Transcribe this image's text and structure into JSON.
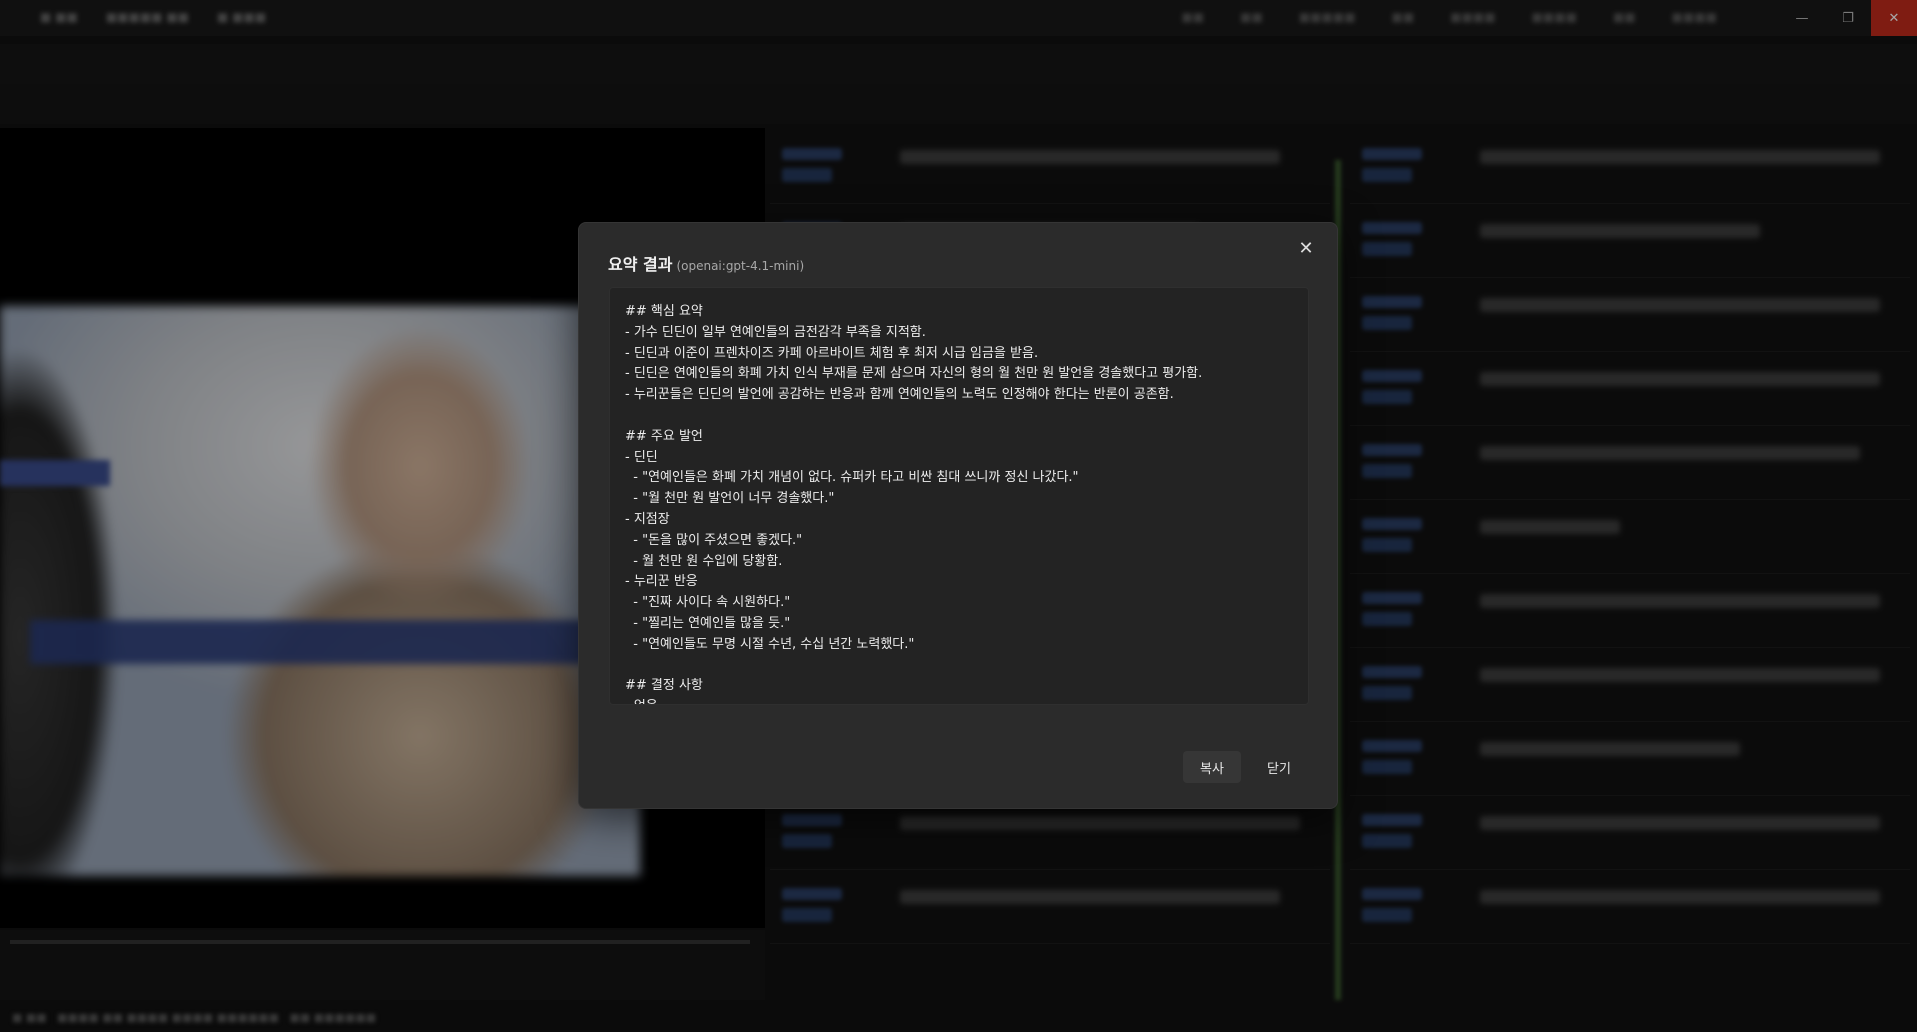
{
  "window": {
    "min_icon": "minimize-icon",
    "max_icon": "maximize-icon",
    "close_icon": "close-icon"
  },
  "dialog": {
    "title": "요약 결과",
    "model": "(openai:gpt-4.1-mini)",
    "summary_text": "## 핵심 요약\n- 가수 딘딘이 일부 연예인들의 금전감각 부족을 지적함.\n- 딘딘과 이준이 프렌차이즈 카페 아르바이트 체험 후 최저 시급 임금을 받음.\n- 딘딘은 연예인들의 화폐 가치 인식 부재를 문제 삼으며 자신의 형의 월 천만 원 발언을 경솔했다고 평가함.\n- 누리꾼들은 딘딘의 발언에 공감하는 반응과 함께 연예인들의 노력도 인정해야 한다는 반론이 공존함.\n\n## 주요 발언\n- 딘딘\n  - \"연예인들은 화폐 가치 개념이 없다. 슈퍼카 타고 비싼 침대 쓰니까 정신 나갔다.\"\n  - \"월 천만 원 발언이 너무 경솔했다.\"\n- 지점장\n  - \"돈을 많이 주셨으면 좋겠다.\"\n  - 월 천만 원 수입에 당황함.\n- 누리꾼 반응\n  - \"진짜 사이다 속 시원하다.\"\n  - \"찔리는 연예인들 많을 듯.\"\n  - \"연예인들도 무명 시절 수년, 수십 년간 노력했다.\"\n\n## 결정 사항\n- 없음",
    "copy_button": "복사",
    "close_button": "닫기",
    "close_icon": "close-icon"
  }
}
